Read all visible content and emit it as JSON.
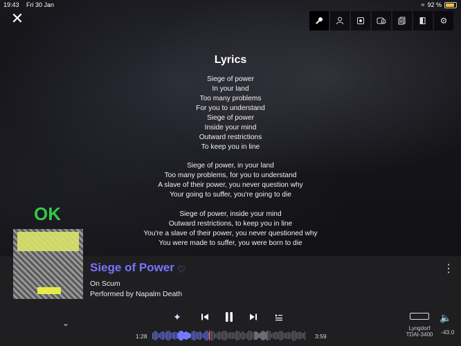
{
  "status": {
    "time": "19:43",
    "date": "Fri 30 Jan",
    "battery": "92 %"
  },
  "toolbar": {
    "icons": [
      "mic-icon",
      "person-icon",
      "speaker-icon",
      "info-icon",
      "document-icon",
      "book-icon",
      "settings-icon"
    ]
  },
  "lyrics": {
    "title": "Lyrics",
    "stanzas": [
      [
        "Siege of power",
        "In your land",
        "Too many problems",
        "For you to understand",
        "Siege of power",
        "Inside your mind",
        "Outward restrictions",
        "To keep you in line"
      ],
      [
        "Siege of power, in your land",
        "Too many problems, for you to understand",
        "A slave of their power, you never question why",
        "Your going to suffer, you're going to die"
      ],
      [
        "Siege of power, inside your mind",
        "Outward restrictions, to keep you in line",
        "You're a slave of their power, you never questioned why",
        "You were made to suffer, you were born to die"
      ]
    ]
  },
  "overlay": {
    "ok": "OK"
  },
  "now_playing": {
    "title": "Siege of Power",
    "album_line": "On Scum",
    "artist_line": "Performed by Napalm Death",
    "elapsed": "1:28",
    "duration": "3:59",
    "progress": 0.368
  },
  "device": {
    "line1": "Lyngdorf",
    "line2": "TDAI-3400",
    "volume": "-43.0"
  },
  "colors": {
    "accent": "#7b73ff",
    "ok": "#33c84a",
    "background": "#1f1f22"
  }
}
